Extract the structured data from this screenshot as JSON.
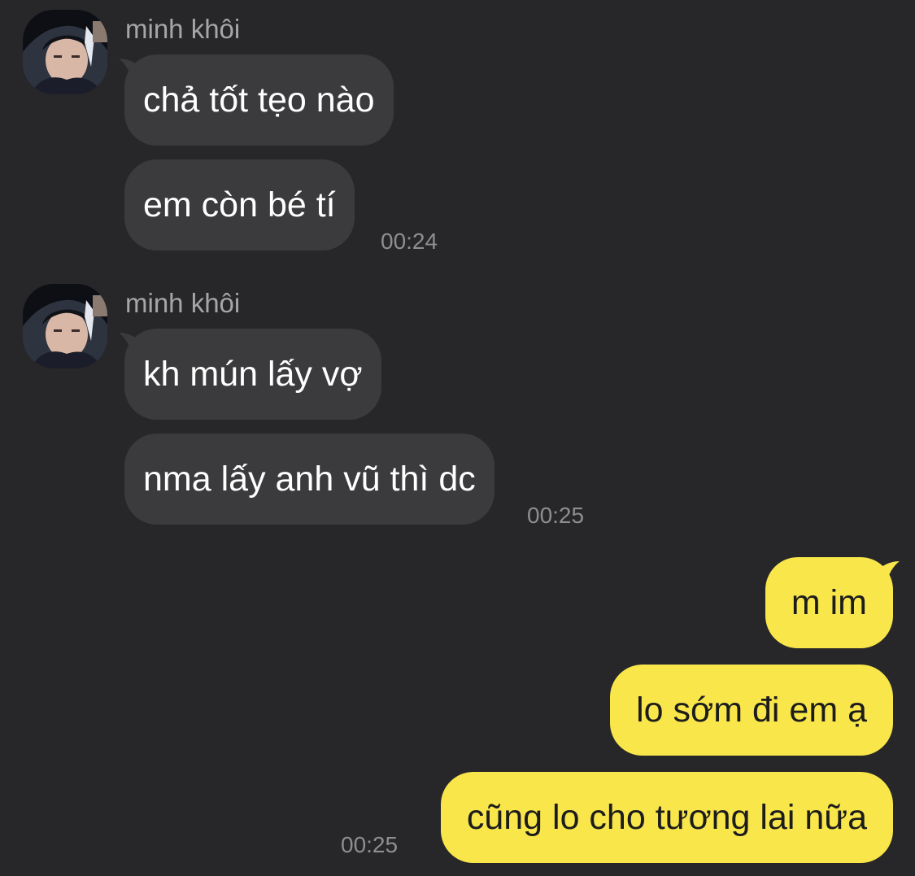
{
  "chat": {
    "incoming_groups": [
      {
        "sender": "minh khôi",
        "avatar_icon": "profile-photo-avatar",
        "messages": [
          "chả tốt tẹo nào",
          "em còn bé tí"
        ],
        "time": "00:24"
      },
      {
        "sender": "minh khôi",
        "avatar_icon": "profile-photo-avatar",
        "messages": [
          "kh mún lấy vợ",
          "nma lấy anh vũ thì dc"
        ],
        "time": "00:25"
      }
    ],
    "outgoing_group": {
      "messages": [
        "m im",
        "lo sớm đi em ạ",
        "cũng lo cho tương lai nữa"
      ],
      "time": "00:25"
    }
  },
  "colors": {
    "background": "#272729",
    "incoming_bubble": "#3b3b3d",
    "outgoing_bubble": "#f9e64a",
    "sender_text": "#a6a6a8",
    "timestamp_text": "#8e8e90"
  }
}
